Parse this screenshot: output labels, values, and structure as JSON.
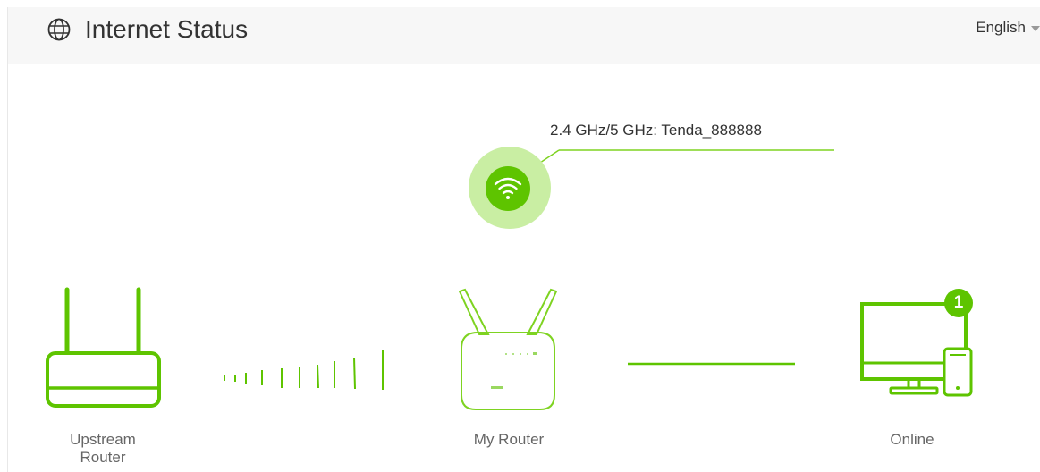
{
  "header": {
    "title": "Internet Status",
    "language": "English"
  },
  "wifi": {
    "ssid_text": "2.4 GHz/5 GHz: Tenda_888888"
  },
  "devices": {
    "upstream_label": "Upstream Router",
    "router_label": "My Router",
    "online_label": "Online",
    "client_count": "1"
  },
  "colors": {
    "accent": "#5ec400",
    "accent_light": "#c9eea3"
  }
}
